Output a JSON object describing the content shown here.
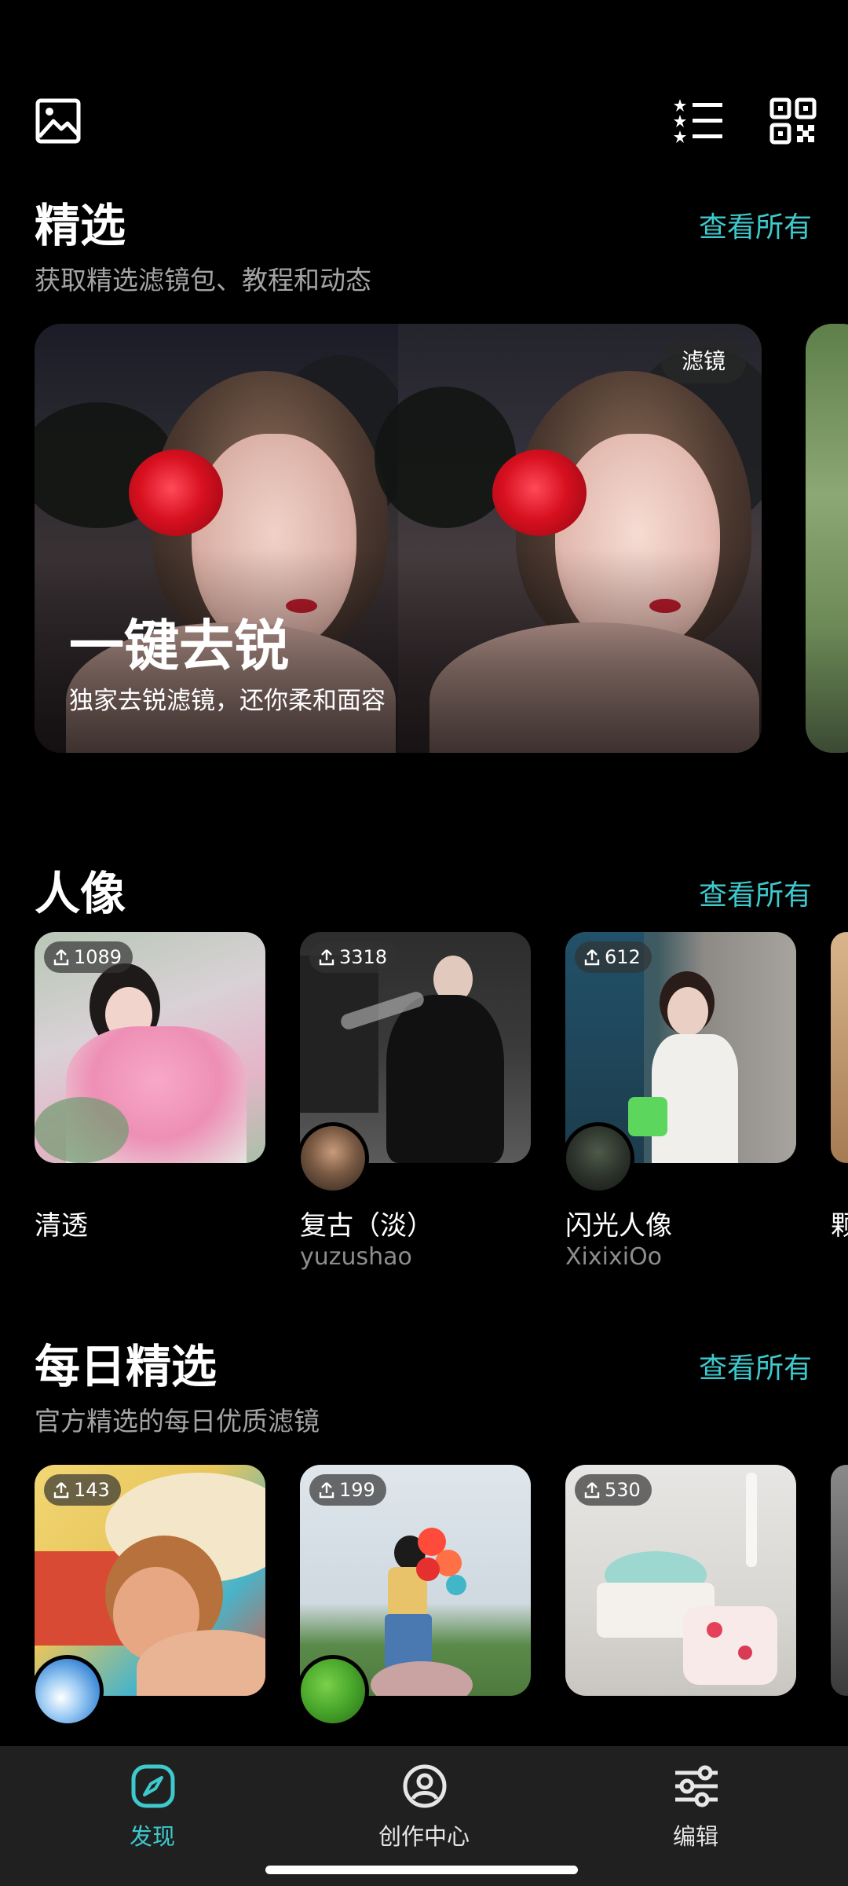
{
  "featured": {
    "title": "精选",
    "see_all": "查看所有",
    "subtitle": "获取精选滤镜包、教程和动态",
    "card": {
      "tag": "滤镜",
      "title": "一键去锐",
      "subtitle": "独家去锐滤镜，还你柔和面容"
    }
  },
  "portrait": {
    "title": "人像",
    "see_all": "查看所有",
    "items": [
      {
        "count": "1089",
        "name": "清透",
        "author": ""
      },
      {
        "count": "3318",
        "name": "复古（淡）",
        "author": "yuzushao"
      },
      {
        "count": "612",
        "name": "闪光人像",
        "author": "XixixiOo"
      },
      {
        "count": "",
        "name": "颗",
        "author": ""
      }
    ]
  },
  "daily": {
    "title": "每日精选",
    "see_all": "查看所有",
    "subtitle": "官方精选的每日优质滤镜",
    "items": [
      {
        "count": "143"
      },
      {
        "count": "199"
      },
      {
        "count": "530"
      }
    ]
  },
  "nav": {
    "items": [
      {
        "label": "发现",
        "icon": "compass-icon",
        "active": true
      },
      {
        "label": "创作中心",
        "icon": "user-circle-icon",
        "active": false
      },
      {
        "label": "编辑",
        "icon": "sliders-icon",
        "active": false
      }
    ]
  },
  "colors": {
    "accent": "#3ec9cd",
    "background": "#000000",
    "nav_bg": "#202020"
  }
}
